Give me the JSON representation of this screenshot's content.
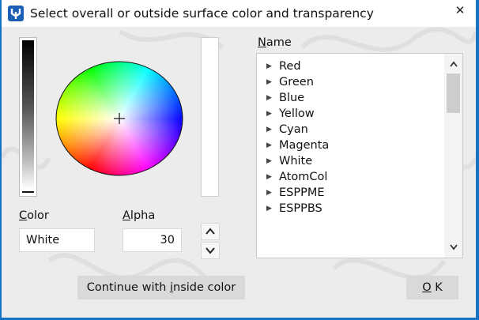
{
  "window": {
    "title": "Select overall or outside surface color and transparency",
    "close_glyph": "✕",
    "app_icon": "app-logo-icon"
  },
  "color_panel": {
    "color_label_accel": "C",
    "color_label_rest": "olor",
    "color_value": "White",
    "alpha_label_accel": "A",
    "alpha_label_rest": "lpha",
    "alpha_value": "30",
    "spin_up_icon": "chevron-up-icon",
    "spin_down_icon": "chevron-down-icon",
    "wheel_crosshair": "+"
  },
  "name_list": {
    "label_accel": "N",
    "label_rest": "ame",
    "items": [
      "Red",
      "Green",
      "Blue",
      "Yellow",
      "Cyan",
      "Magenta",
      "White",
      "AtomCol",
      "ESPPME",
      "ESPPBS"
    ],
    "expand_icon": "▶",
    "scroll_up_glyph": "▲",
    "scroll_down_glyph": "▼"
  },
  "buttons": {
    "continue_pre": "Continue with ",
    "continue_accel": "i",
    "continue_post": "nside color",
    "ok_accel": "O",
    "ok_rest": "K"
  }
}
